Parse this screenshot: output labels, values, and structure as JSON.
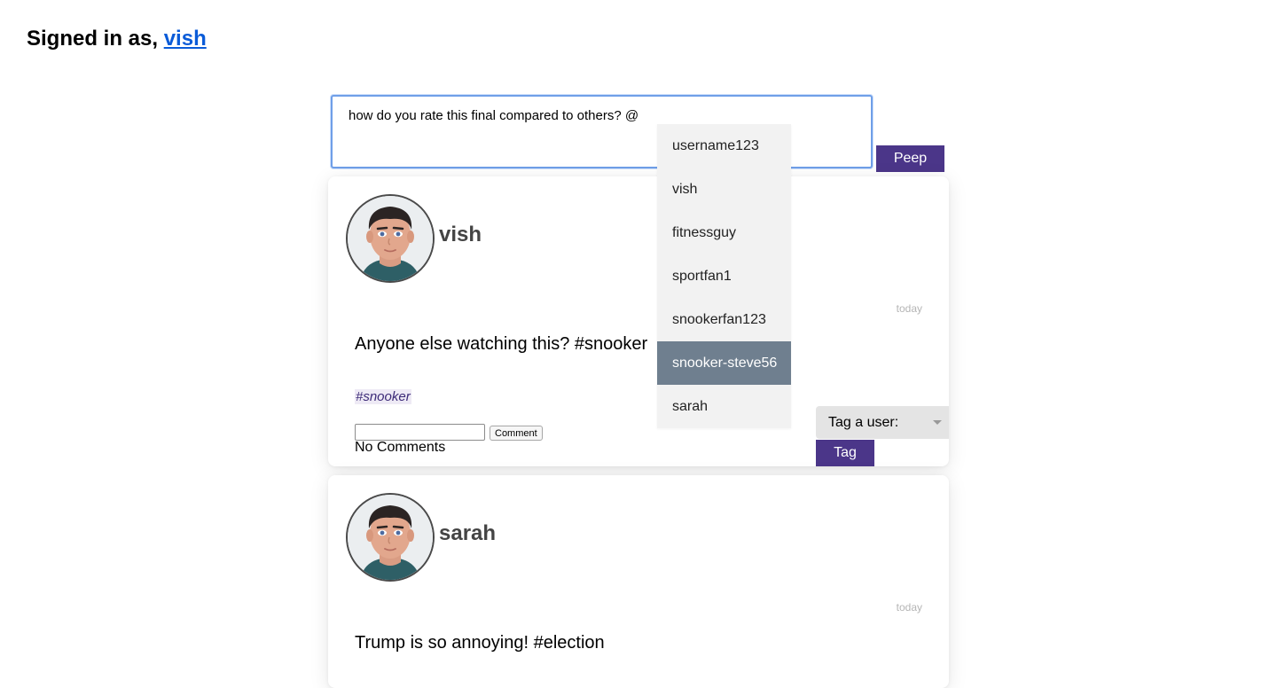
{
  "header": {
    "signed_in_prefix": "Signed in as,",
    "username": "vish"
  },
  "compose": {
    "text": "how do you rate this final compared to others? @",
    "peep_label": "Peep"
  },
  "mention_dropdown": {
    "items": [
      "username123",
      "vish",
      "fitnessguy",
      "sportfan1",
      "snookerfan123",
      "snooker-steve56",
      "sarah"
    ],
    "selected": "snooker-steve56"
  },
  "posts": [
    {
      "author": "vish",
      "timestamp": "today",
      "text": "Anyone else watching this? #snooker",
      "hashtag": "#snooker",
      "comment_button": "Comment",
      "comments_status": "No Comments",
      "tag_select_label": "Tag a user:",
      "tag_button": "Tag"
    },
    {
      "author": "sarah",
      "timestamp": "today",
      "text": "Trump is so annoying! #election"
    }
  ],
  "colors": {
    "accent": "#4b3689",
    "link": "#0a5bd8",
    "dropdown_active": "#6f7f8f"
  },
  "icons": {
    "avatar": "cartoon-avatar-icon",
    "select_caret": "caret-down-icon"
  }
}
